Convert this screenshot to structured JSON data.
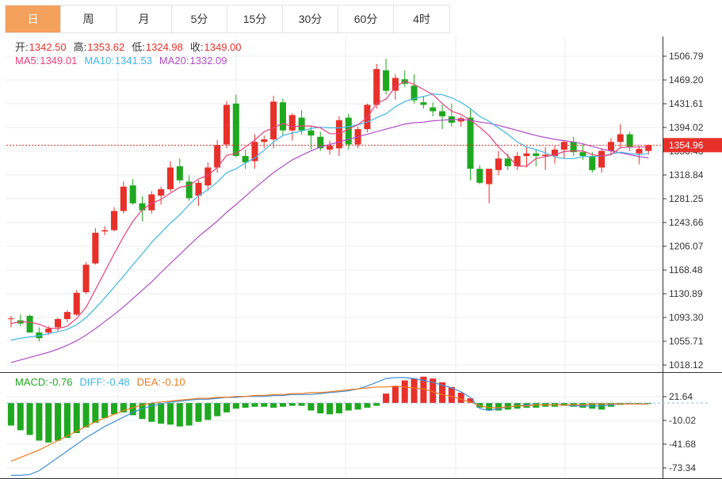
{
  "tabs": [
    "日",
    "周",
    "月",
    "5分",
    "15分",
    "30分",
    "60分",
    "4时"
  ],
  "active_tab": 0,
  "ohlc_info": [
    {
      "label": "开:",
      "value": "1342.50"
    },
    {
      "label": "高:",
      "value": "1353.62"
    },
    {
      "label": "低:",
      "value": "1324.98"
    },
    {
      "label": "收:",
      "value": "1349.00"
    }
  ],
  "ma_info": [
    {
      "label": "MA5:",
      "value": "1349.01"
    },
    {
      "label": "MA10:",
      "value": "1341.53"
    },
    {
      "label": "MA20:",
      "value": "1332.09"
    }
  ],
  "macd_info": [
    {
      "label": "MACD:",
      "value": "-0.76"
    },
    {
      "label": "DIFF:",
      "value": "-0.48"
    },
    {
      "label": "DEA:",
      "value": "-0.10"
    }
  ],
  "colors": {
    "up": "#e8302a",
    "down": "#1fa81f",
    "ma5": "#e8417a",
    "ma10": "#3fb6e8",
    "ma20": "#b04cc6",
    "diff": "#3e8fd9",
    "dea": "#f07a1c",
    "label": "#333333",
    "value_red": "#e8302a",
    "macd_label": "#1fa81f",
    "diff_label": "#3fb6e8",
    "dea_label": "#f07a1c"
  },
  "chart_data": [
    {
      "type": "candlestick",
      "ylim": [
        1000,
        1525
      ],
      "y_ticks": [
        "1506.79",
        "1469.20",
        "1431.61",
        "1394.02",
        "1356.43",
        "1318.84",
        "1281.25",
        "1243.66",
        "1206.07",
        "1168.48",
        "1130.89",
        "1093.30",
        "1055.71",
        "1018.12"
      ],
      "last_price": "1354.96",
      "candles": [
        [
          1083,
          1088,
          1070,
          1084
        ],
        [
          1081,
          1090,
          1072,
          1076
        ],
        [
          1088,
          1090,
          1062,
          1062
        ],
        [
          1062,
          1070,
          1048,
          1053
        ],
        [
          1062,
          1072,
          1058,
          1068
        ],
        [
          1070,
          1085,
          1064,
          1083
        ],
        [
          1083,
          1097,
          1078,
          1094
        ],
        [
          1090,
          1128,
          1088,
          1124
        ],
        [
          1125,
          1172,
          1122,
          1168
        ],
        [
          1170,
          1225,
          1168,
          1218
        ],
        [
          1220,
          1228,
          1214,
          1222
        ],
        [
          1222,
          1258,
          1220,
          1252
        ],
        [
          1252,
          1298,
          1248,
          1290
        ],
        [
          1292,
          1302,
          1262,
          1264
        ],
        [
          1264,
          1275,
          1236,
          1253
        ],
        [
          1253,
          1283,
          1248,
          1278
        ],
        [
          1276,
          1290,
          1262,
          1286
        ],
        [
          1286,
          1330,
          1282,
          1320
        ],
        [
          1322,
          1334,
          1296,
          1300
        ],
        [
          1298,
          1308,
          1268,
          1272
        ],
        [
          1276,
          1300,
          1260,
          1296
        ],
        [
          1292,
          1328,
          1284,
          1320
        ],
        [
          1320,
          1363,
          1312,
          1355
        ],
        [
          1356,
          1424,
          1350,
          1418
        ],
        [
          1420,
          1434,
          1336,
          1338
        ],
        [
          1338,
          1348,
          1318,
          1328
        ],
        [
          1330,
          1372,
          1318,
          1360
        ],
        [
          1360,
          1370,
          1350,
          1364
        ],
        [
          1364,
          1432,
          1350,
          1423
        ],
        [
          1422,
          1428,
          1370,
          1378
        ],
        [
          1378,
          1405,
          1362,
          1402
        ],
        [
          1398,
          1410,
          1372,
          1378
        ],
        [
          1378,
          1384,
          1348,
          1370
        ],
        [
          1368,
          1376,
          1346,
          1350
        ],
        [
          1348,
          1362,
          1340,
          1354
        ],
        [
          1350,
          1400,
          1338,
          1394
        ],
        [
          1398,
          1404,
          1348,
          1356
        ],
        [
          1356,
          1384,
          1350,
          1380
        ],
        [
          1380,
          1420,
          1375,
          1418
        ],
        [
          1418,
          1482,
          1412,
          1474
        ],
        [
          1472,
          1490,
          1434,
          1440
        ],
        [
          1440,
          1466,
          1426,
          1460
        ],
        [
          1458,
          1472,
          1446,
          1451
        ],
        [
          1448,
          1466,
          1420,
          1425
        ],
        [
          1422,
          1432,
          1412,
          1418
        ],
        [
          1414,
          1422,
          1400,
          1408
        ],
        [
          1408,
          1418,
          1380,
          1400
        ],
        [
          1400,
          1420,
          1384,
          1390
        ],
        [
          1392,
          1400,
          1384,
          1397
        ],
        [
          1398,
          1412,
          1300,
          1318
        ],
        [
          1318,
          1324,
          1294,
          1296
        ],
        [
          1294,
          1316,
          1264,
          1318
        ],
        [
          1316,
          1346,
          1308,
          1334
        ],
        [
          1334,
          1342,
          1316,
          1322
        ],
        [
          1322,
          1344,
          1316,
          1338
        ],
        [
          1338,
          1352,
          1320,
          1342
        ],
        [
          1342,
          1348,
          1322,
          1338
        ],
        [
          1338,
          1352,
          1316,
          1340
        ],
        [
          1338,
          1354,
          1326,
          1348
        ],
        [
          1348,
          1362,
          1334,
          1360
        ],
        [
          1360,
          1368,
          1338,
          1344
        ],
        [
          1344,
          1356,
          1332,
          1338
        ],
        [
          1338,
          1344,
          1312,
          1316
        ],
        [
          1320,
          1350,
          1312,
          1346
        ],
        [
          1346,
          1366,
          1340,
          1360
        ],
        [
          1360,
          1388,
          1350,
          1372
        ],
        [
          1372,
          1376,
          1346,
          1352
        ],
        [
          1342,
          1354,
          1325,
          1349
        ],
        [
          1346,
          1356,
          1340,
          1355
        ]
      ],
      "ma5": [
        1076,
        1079,
        1078,
        1075,
        1069,
        1068,
        1072,
        1084,
        1101,
        1129,
        1157,
        1185,
        1212,
        1236,
        1254,
        1264,
        1270,
        1280,
        1289,
        1292,
        1302,
        1308,
        1320,
        1339,
        1342,
        1352,
        1363,
        1376,
        1382,
        1389,
        1384,
        1385,
        1385,
        1382,
        1373,
        1373,
        1380,
        1387,
        1398,
        1420,
        1427,
        1446,
        1455,
        1450,
        1442,
        1434,
        1420,
        1408,
        1403,
        1394,
        1383,
        1370,
        1352,
        1338,
        1322,
        1322,
        1334,
        1337,
        1340,
        1345,
        1346,
        1346,
        1340,
        1338,
        1340,
        1351,
        1352,
        1352,
        1352
      ],
      "ma10": [
        1050,
        1053,
        1055,
        1057,
        1060,
        1063,
        1067,
        1074,
        1085,
        1100,
        1116,
        1133,
        1150,
        1168,
        1185,
        1203,
        1218,
        1233,
        1246,
        1262,
        1276,
        1285,
        1297,
        1312,
        1318,
        1327,
        1335,
        1347,
        1360,
        1370,
        1374,
        1377,
        1381,
        1383,
        1382,
        1382,
        1384,
        1387,
        1391,
        1398,
        1404,
        1415,
        1423,
        1428,
        1431,
        1435,
        1434,
        1429,
        1422,
        1412,
        1400,
        1392,
        1382,
        1372,
        1360,
        1352,
        1348,
        1343,
        1337,
        1334,
        1334,
        1337,
        1337,
        1338,
        1341,
        1344,
        1342,
        1340,
        1342
      ],
      "ma20": [
        1015,
        1019,
        1023,
        1027,
        1031,
        1036,
        1042,
        1049,
        1058,
        1068,
        1079,
        1090,
        1102,
        1115,
        1128,
        1141,
        1156,
        1170,
        1184,
        1198,
        1212,
        1224,
        1236,
        1250,
        1262,
        1275,
        1288,
        1300,
        1312,
        1322,
        1332,
        1339,
        1346,
        1352,
        1356,
        1360,
        1364,
        1368,
        1372,
        1376,
        1380,
        1384,
        1388,
        1390,
        1391,
        1393,
        1394,
        1395,
        1395,
        1394,
        1391,
        1389,
        1386,
        1382,
        1378,
        1374,
        1370,
        1367,
        1364,
        1362,
        1360,
        1357,
        1353,
        1349,
        1346,
        1343,
        1340,
        1337,
        1335
      ]
    },
    {
      "type": "bar",
      "name": "MACD",
      "ylim": [
        -80,
        32
      ],
      "y_ticks": [
        "21.64",
        "-10.02",
        "-41.68",
        "-73.34"
      ],
      "macd": [
        -24,
        -29,
        -34,
        -40,
        -42,
        -40,
        -37,
        -32,
        -26,
        -21,
        -16,
        -12,
        -10,
        -13,
        -17,
        -20,
        -22,
        -23,
        -25,
        -24,
        -20,
        -18,
        -14,
        -10,
        -6,
        -5,
        -4,
        -4,
        -5,
        -4,
        -3,
        -3,
        -8,
        -11,
        -12,
        -11,
        -8,
        -7,
        -5,
        -3,
        10,
        18,
        24,
        26,
        28,
        26,
        22,
        17,
        11,
        5,
        -5,
        -8,
        -8,
        -7,
        -6,
        -5,
        -5,
        -4,
        -4,
        -3,
        -4,
        -5,
        -6,
        -7,
        -4,
        -2,
        -1,
        -1,
        -1
      ],
      "diff": [
        -77,
        -77,
        -76,
        -72,
        -65,
        -58,
        -51,
        -44,
        -37,
        -31,
        -25,
        -20,
        -15,
        -10,
        -6,
        -3,
        -1,
        1,
        2,
        3,
        4,
        4,
        5,
        6,
        6,
        7,
        7,
        7,
        8,
        8,
        9,
        9,
        9,
        10,
        11,
        12,
        13,
        15,
        18,
        22,
        26,
        27,
        27,
        26,
        24,
        22,
        19,
        16,
        12,
        6,
        -6,
        -8,
        -6,
        -4,
        -3,
        -2,
        -2,
        -2,
        -2,
        -2,
        -3,
        -3,
        -3,
        -3,
        -2,
        -1,
        -1,
        -1,
        -1
      ],
      "dea": [
        -62,
        -58,
        -54,
        -50,
        -45,
        -40,
        -35,
        -30,
        -25,
        -20,
        -16,
        -12,
        -8,
        -5,
        -2,
        0,
        1,
        2,
        3,
        4,
        5,
        5,
        6,
        6,
        7,
        7,
        8,
        8,
        9,
        9,
        10,
        10,
        11,
        11,
        12,
        13,
        14,
        15,
        16,
        17,
        17,
        18,
        17,
        16,
        15,
        12,
        9,
        7,
        4,
        1,
        -3,
        -5,
        -5,
        -4,
        -3,
        -3,
        -2,
        -2,
        -2,
        -2,
        -2,
        -2,
        -1,
        -1,
        -1,
        -1,
        -1,
        -1,
        -1
      ]
    }
  ]
}
